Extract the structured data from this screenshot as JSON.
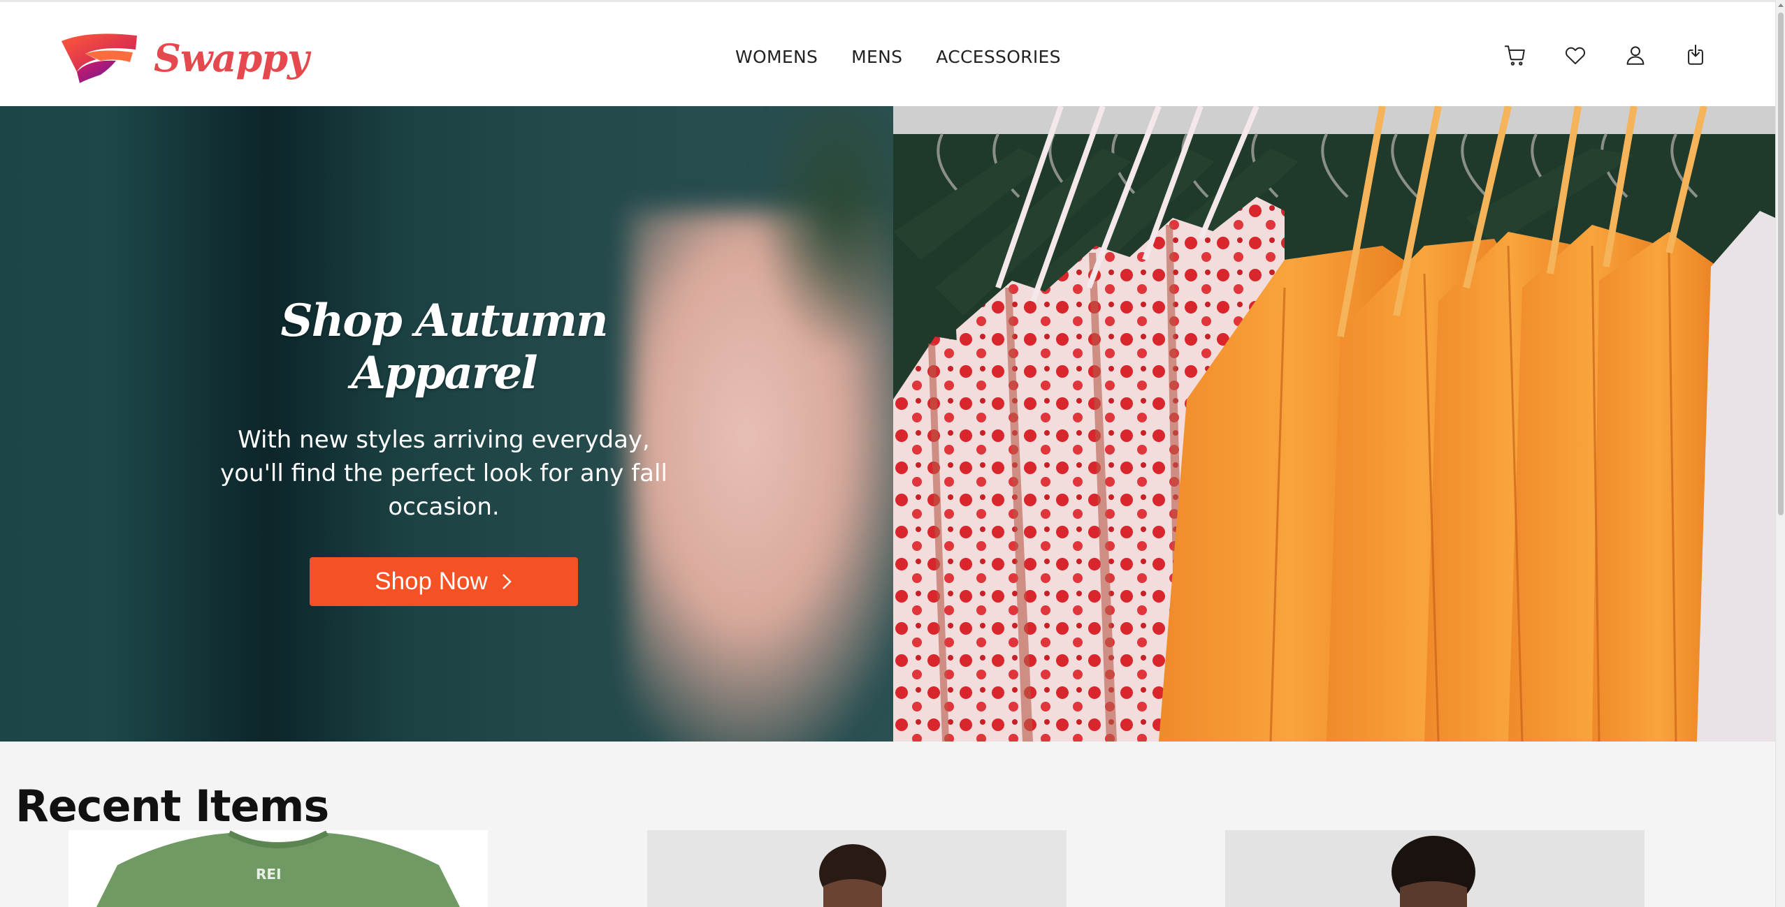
{
  "brand": {
    "name": "Swappy",
    "accent": "#e5484d"
  },
  "nav": {
    "items": [
      "WOMENS",
      "MENS",
      "ACCESSORIES"
    ]
  },
  "header_icons": [
    "cart-icon",
    "heart-icon",
    "user-icon",
    "download-icon"
  ],
  "hero": {
    "title": "Shop Autumn Apparel",
    "subtitle": "With new styles arriving everyday, you'll find the perfect look for any fall occasion.",
    "cta_label": "Shop Now",
    "cta_color": "#f45124"
  },
  "recent": {
    "title": "Recent Items",
    "cards": [
      {
        "type": "tshirt-image"
      },
      {
        "type": "model-image"
      },
      {
        "type": "model-image"
      }
    ]
  }
}
